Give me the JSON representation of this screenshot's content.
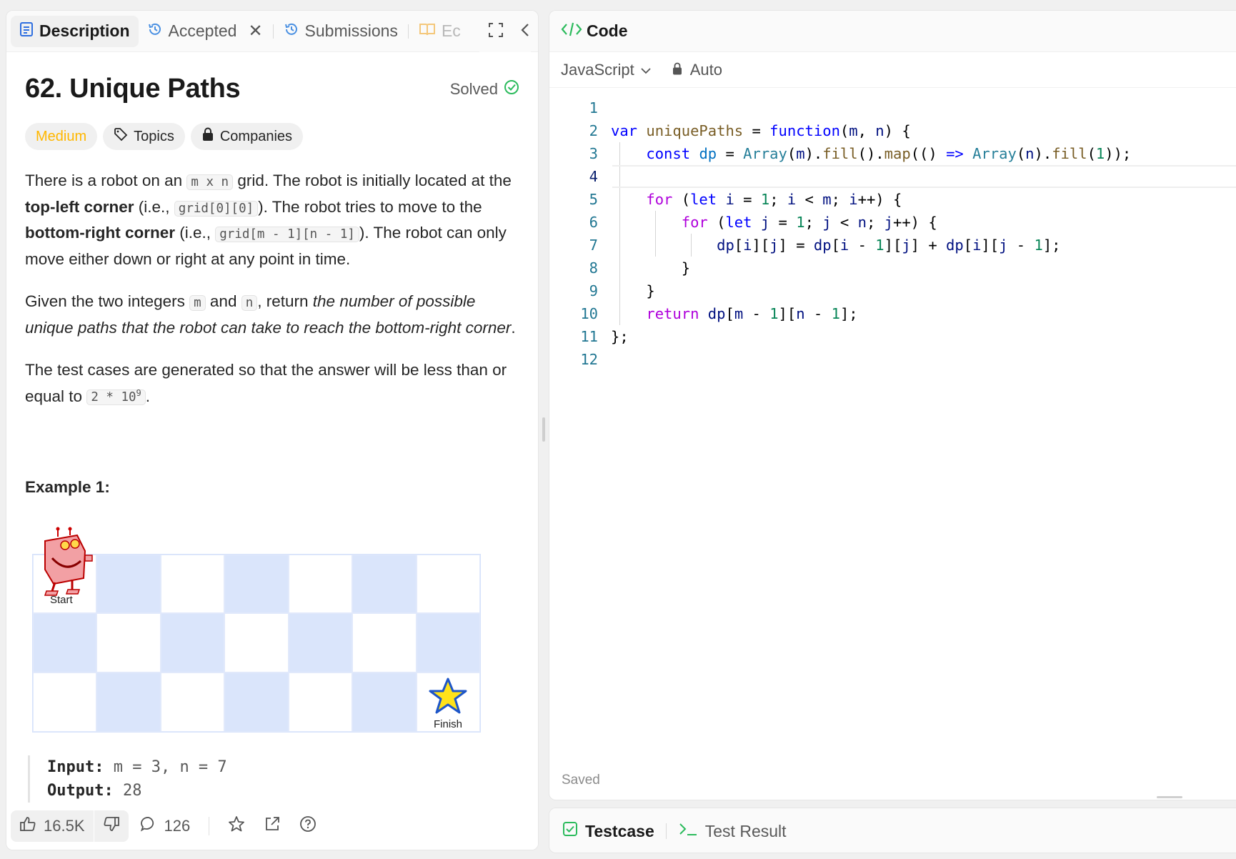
{
  "tabs": {
    "description": "Description",
    "accepted": "Accepted",
    "submissions": "Submissions",
    "editorial_partial": "Ec"
  },
  "problem": {
    "title": "62. Unique Paths",
    "status": "Solved",
    "difficulty": "Medium",
    "topics_label": "Topics",
    "companies_label": "Companies",
    "p1": {
      "t1": "There is a robot on an ",
      "c1": "m x n",
      "t2": " grid. The robot is initially located at the ",
      "b1": "top-left corner",
      "t3": " (i.e., ",
      "c2": "grid[0][0]",
      "t4": "). The robot tries to move to the ",
      "b2": "bottom-right corner",
      "t5": " (i.e., ",
      "c3": "grid[m - 1][n - 1]",
      "t6": "). The robot can only move either down or right at any point in time."
    },
    "p2": {
      "t1": "Given the two integers ",
      "c1": "m",
      "t2": " and ",
      "c2": "n",
      "t3": ", return ",
      "e1": "the number of possible unique paths that the robot can take to reach the bottom-right corner",
      "t4": "."
    },
    "p3": {
      "t1": "The test cases are generated so that the answer will be less than or equal to ",
      "c1_base": "2 * 10",
      "c1_exp": "9",
      "t2": "."
    },
    "example_title": "Example 1:",
    "start_label": "Start",
    "finish_label": "Finish",
    "input_label": "Input:",
    "input_value": " m = 3, n = 7",
    "output_label": "Output:",
    "output_value": " 28"
  },
  "bottom_bar": {
    "likes": "16.5K",
    "comments": "126"
  },
  "code_panel": {
    "header": "Code",
    "language": "JavaScript",
    "mode": "Auto",
    "saved": "Saved",
    "current_line": 4
  },
  "bottom_tabs": {
    "testcase": "Testcase",
    "test_result": "Test Result"
  },
  "colors": {
    "accent_green": "#2cbb5d",
    "medium": "#ffb700",
    "grid_blue": "#dae5fb",
    "keyword_blue": "#0000ff",
    "keyword_purple": "#af00db"
  },
  "icons": [
    "description-icon",
    "history-icon",
    "book-icon",
    "fullscreen-icon",
    "collapse-icon",
    "check-circle-icon",
    "tag-icon",
    "lock-icon",
    "code-icon",
    "chevron-down-icon",
    "thumbs-up-icon",
    "thumbs-down-icon",
    "comment-icon",
    "star-icon",
    "share-icon",
    "help-icon",
    "checkbox-icon",
    "terminal-icon"
  ]
}
